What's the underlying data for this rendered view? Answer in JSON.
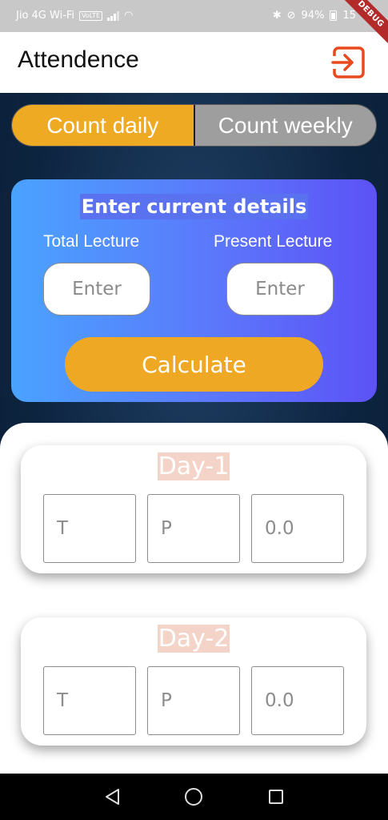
{
  "status_bar": {
    "carrier": "Jio 4G Wi-Fi",
    "volte": "VoLTE",
    "battery": "94%",
    "time": "15",
    "debug": "DEBUG"
  },
  "app_bar": {
    "title": "Attendence",
    "logout_icon": "logout-icon"
  },
  "mode_toggle": {
    "options": [
      "Count daily",
      "Count weekly"
    ],
    "selected": "Count daily"
  },
  "details_card": {
    "title": "Enter current details",
    "total_label": "Total Lecture",
    "present_label": "Present Lecture",
    "total_placeholder": "Enter",
    "present_placeholder": "Enter",
    "calculate_label": "Calculate"
  },
  "days": [
    {
      "title": "Day-1",
      "total_placeholder": "T",
      "present_placeholder": "P",
      "percent_placeholder": "0.0"
    },
    {
      "title": "Day-2",
      "total_placeholder": "T",
      "present_placeholder": "P",
      "percent_placeholder": "0.0"
    }
  ],
  "colors": {
    "accent_orange": "#efaa24",
    "card_gradient_start": "#4aa3ff",
    "card_gradient_end": "#5d52f6",
    "logout_icon": "#e8491d",
    "day_title_bg": "#f4d4c8"
  },
  "nav_bar": {
    "icons": [
      "back-icon",
      "home-icon",
      "recents-icon"
    ]
  }
}
